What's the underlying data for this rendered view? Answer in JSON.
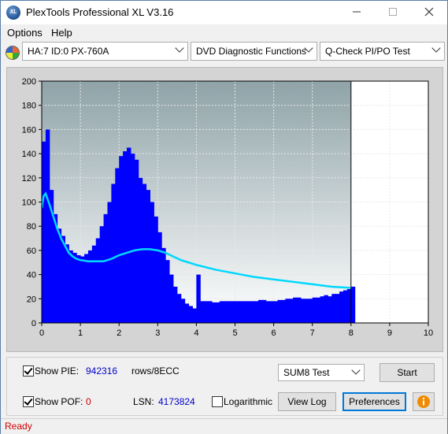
{
  "window": {
    "title": "PlexTools Professional XL V3.16",
    "icon_label": "XL"
  },
  "menu": {
    "items": [
      "Options",
      "Help"
    ]
  },
  "toolbar": {
    "drive": "HA:7 ID:0  PX-760A",
    "function": "DVD Diagnostic Functions",
    "test": "Q-Check PI/PO Test"
  },
  "chart_data": {
    "type": "area",
    "xlim": [
      0,
      10
    ],
    "ylim": [
      0,
      200
    ],
    "x_ticks": [
      "0",
      "1",
      "2",
      "3",
      "4",
      "5",
      "6",
      "7",
      "8",
      "9",
      "10"
    ],
    "y_ticks": [
      "0",
      "20",
      "40",
      "60",
      "80",
      "100",
      "120",
      "140",
      "160",
      "180",
      "200"
    ],
    "marker_x": 8,
    "colors": {
      "pie_bars": "#0000ff",
      "pof_line": "#00d8ff",
      "bg_top": "#8fa3a8",
      "bg_bottom": "#ffffff",
      "grid": "#e8e8e8"
    },
    "series": [
      {
        "type": "bar",
        "x": [
          0.0,
          0.1,
          0.2,
          0.3,
          0.4,
          0.5,
          0.6,
          0.7,
          0.8,
          0.9,
          1.0,
          1.1,
          1.2,
          1.3,
          1.4,
          1.5,
          1.6,
          1.7,
          1.8,
          1.9,
          2.0,
          2.1,
          2.2,
          2.3,
          2.4,
          2.5,
          2.6,
          2.7,
          2.8,
          2.9,
          3.0,
          3.1,
          3.2,
          3.3,
          3.4,
          3.5,
          3.6,
          3.7,
          3.8,
          3.9,
          4.0,
          4.1,
          4.2,
          4.3,
          4.4,
          4.5,
          4.6,
          4.7,
          4.8,
          4.9,
          5.0,
          5.1,
          5.2,
          5.3,
          5.4,
          5.5,
          5.6,
          5.7,
          5.8,
          5.9,
          6.0,
          6.1,
          6.2,
          6.3,
          6.4,
          6.5,
          6.6,
          6.7,
          6.8,
          6.9,
          7.0,
          7.1,
          7.2,
          7.3,
          7.4,
          7.5,
          7.6,
          7.7,
          7.8,
          7.9,
          8.0
        ],
        "values": [
          150,
          160,
          110,
          90,
          78,
          72,
          65,
          60,
          58,
          56,
          55,
          57,
          60,
          64,
          70,
          80,
          90,
          100,
          115,
          128,
          138,
          142,
          145,
          140,
          135,
          120,
          115,
          110,
          100,
          88,
          75,
          62,
          52,
          40,
          30,
          24,
          20,
          16,
          14,
          12,
          40,
          18,
          18,
          18,
          17,
          17,
          18,
          18,
          18,
          18,
          18,
          18,
          18,
          18,
          18,
          18,
          19,
          19,
          18,
          18,
          18,
          19,
          19,
          20,
          20,
          21,
          21,
          20,
          20,
          20,
          21,
          21,
          22,
          23,
          22,
          24,
          24,
          26,
          27,
          28,
          30
        ]
      },
      {
        "type": "line",
        "x": [
          0.0,
          0.05,
          0.1,
          0.2,
          0.3,
          0.4,
          0.5,
          0.6,
          0.7,
          0.8,
          0.9,
          1.0,
          1.2,
          1.4,
          1.6,
          1.8,
          2.0,
          2.2,
          2.4,
          2.6,
          2.8,
          3.0,
          3.2,
          3.4,
          3.6,
          3.8,
          4.0,
          4.5,
          5.0,
          5.5,
          6.0,
          6.5,
          7.0,
          7.5,
          8.0
        ],
        "values": [
          95,
          105,
          107,
          98,
          88,
          78,
          70,
          64,
          58,
          55,
          53,
          52,
          51,
          51,
          51,
          53,
          56,
          58,
          60,
          61,
          61,
          60,
          58,
          55,
          52,
          50,
          48,
          44,
          41,
          38,
          36,
          34,
          32,
          30,
          29
        ]
      }
    ]
  },
  "controls": {
    "show_pie_label": "Show PIE:",
    "pie_value": "942316",
    "pie_unit": "rows/8ECC",
    "show_pof_label": "Show POF:",
    "pof_value": "0",
    "lsn_label": "LSN:",
    "lsn_value": "4173824",
    "logarithmic_label": "Logarithmic",
    "sum_select": "SUM8 Test",
    "start_button": "Start",
    "view_log_button": "View Log",
    "preferences_button": "Preferences",
    "info_icon": "info-icon"
  },
  "status": {
    "text": "Ready"
  }
}
